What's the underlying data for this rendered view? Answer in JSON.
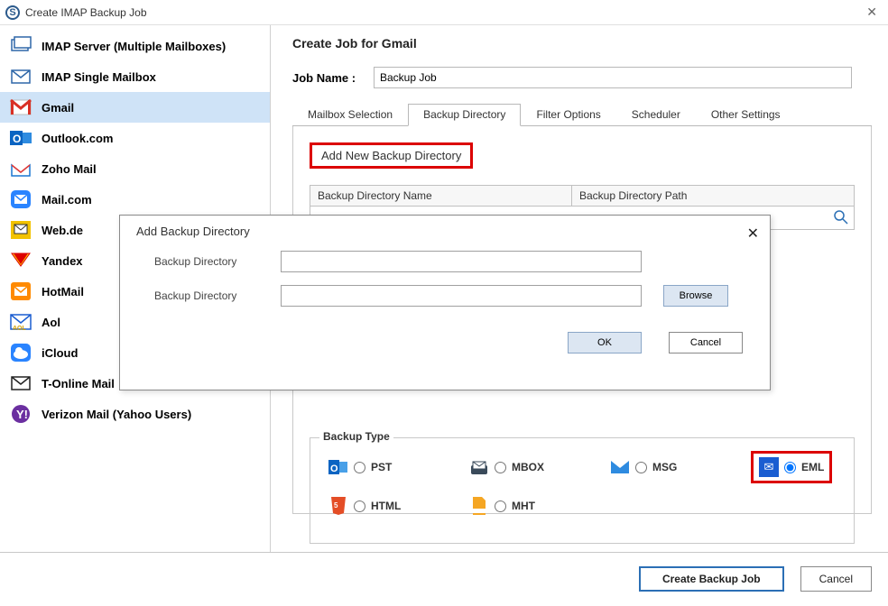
{
  "window": {
    "title": "Create IMAP Backup Job"
  },
  "sidebar": {
    "items": [
      {
        "label": "IMAP Server (Multiple Mailboxes)"
      },
      {
        "label": "IMAP Single Mailbox"
      },
      {
        "label": "Gmail"
      },
      {
        "label": "Outlook.com"
      },
      {
        "label": "Zoho Mail"
      },
      {
        "label": "Mail.com"
      },
      {
        "label": "Web.de"
      },
      {
        "label": "Yandex"
      },
      {
        "label": "HotMail"
      },
      {
        "label": "Aol"
      },
      {
        "label": "iCloud"
      },
      {
        "label": "T-Online Mail"
      },
      {
        "label": "Verizon Mail (Yahoo Users)"
      }
    ]
  },
  "header": {
    "title": "Create Job for Gmail",
    "jobname_label": "Job Name :",
    "jobname_value": "Backup Job"
  },
  "tabs": [
    "Mailbox Selection",
    "Backup Directory",
    "Filter Options",
    "Scheduler",
    "Other Settings"
  ],
  "active_tab": "Backup Directory",
  "panel": {
    "add_new": "Add New Backup Directory",
    "col1": "Backup Directory Name",
    "col2": "Backup Directory Path"
  },
  "backup_type": {
    "legend": "Backup Type",
    "options": [
      "PST",
      "MBOX",
      "MSG",
      "EML",
      "HTML",
      "MHT"
    ],
    "selected": "EML"
  },
  "dialog": {
    "title": "Add Backup Directory",
    "field1": "Backup Directory",
    "field2": "Backup Directory",
    "browse": "Browse",
    "ok": "OK",
    "cancel": "Cancel"
  },
  "footer": {
    "create": "Create Backup Job",
    "cancel": "Cancel"
  }
}
